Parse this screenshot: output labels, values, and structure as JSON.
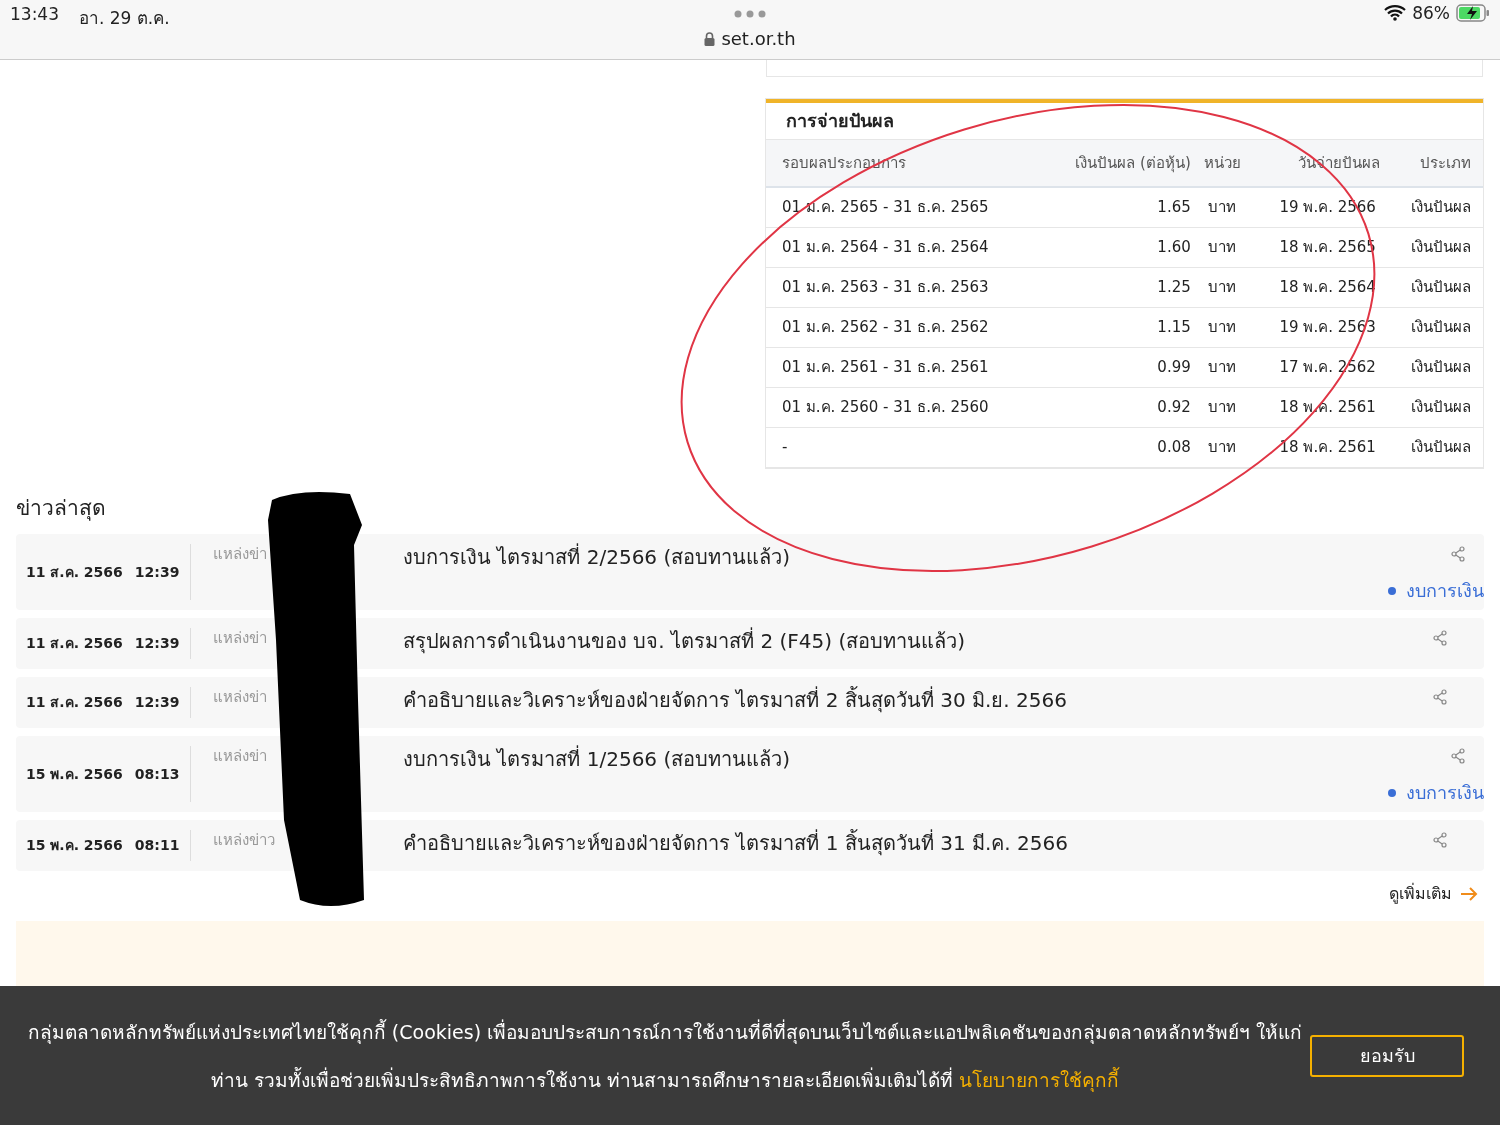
{
  "status_bar": {
    "time": "13:43",
    "date": "อา. 29 ต.ค.",
    "url": "set.or.th",
    "battery": "86%"
  },
  "dividend": {
    "title": "การจ่ายปันผล",
    "columns": [
      "รอบผลประกอบการ",
      "เงินปันผล (ต่อหุ้น)",
      "หน่วย",
      "วันจ่ายปันผล",
      "ประเภท"
    ],
    "rows": [
      {
        "period": "01 ม.ค. 2565 - 31 ธ.ค. 2565",
        "amount": "1.65",
        "unit": "บาท",
        "pay_date": "19 พ.ค. 2566",
        "type": "เงินปันผล"
      },
      {
        "period": "01 ม.ค. 2564 - 31 ธ.ค. 2564",
        "amount": "1.60",
        "unit": "บาท",
        "pay_date": "18 พ.ค. 2565",
        "type": "เงินปันผล"
      },
      {
        "period": "01 ม.ค. 2563 - 31 ธ.ค. 2563",
        "amount": "1.25",
        "unit": "บาท",
        "pay_date": "18 พ.ค. 2564",
        "type": "เงินปันผล"
      },
      {
        "period": "01 ม.ค. 2562 - 31 ธ.ค. 2562",
        "amount": "1.15",
        "unit": "บาท",
        "pay_date": "19 พ.ค. 2563",
        "type": "เงินปันผล"
      },
      {
        "period": "01 ม.ค. 2561 - 31 ธ.ค. 2561",
        "amount": "0.99",
        "unit": "บาท",
        "pay_date": "17 พ.ค. 2562",
        "type": "เงินปันผล"
      },
      {
        "period": "01 ม.ค. 2560 - 31 ธ.ค. 2560",
        "amount": "0.92",
        "unit": "บาท",
        "pay_date": "18 พ.ค. 2561",
        "type": "เงินปันผล"
      },
      {
        "period": "-",
        "amount": "0.08",
        "unit": "บาท",
        "pay_date": "18 พ.ค. 2561",
        "type": "เงินปันผล"
      }
    ]
  },
  "news": {
    "title": "ข่าวล่าสุด",
    "items": [
      {
        "date": "11 ส.ค. 2566",
        "time": "12:39",
        "source": "แหล่งข่า",
        "headline": "งบการเงิน ไตรมาสที่ 2/2566 (สอบทานแล้ว)",
        "tag": "งบการเงิน"
      },
      {
        "date": "11 ส.ค. 2566",
        "time": "12:39",
        "source": "แหล่งข่า",
        "headline": "สรุปผลการดำเนินงานของ บจ. ไตรมาสที่ 2 (F45) (สอบทานแล้ว)"
      },
      {
        "date": "11 ส.ค. 2566",
        "time": "12:39",
        "source": "แหล่งข่า",
        "headline": "คำอธิบายและวิเคราะห์ของฝ่ายจัดการ ไตรมาสที่ 2 สิ้นสุดวันที่ 30 มิ.ย. 2566"
      },
      {
        "date": "15 พ.ค. 2566",
        "time": "08:13",
        "source": "แหล่งข่า",
        "headline": "งบการเงิน ไตรมาสที่ 1/2566 (สอบทานแล้ว)",
        "tag": "งบการเงิน"
      },
      {
        "date": "15 พ.ค. 2566",
        "time": "08:11",
        "source": "แหล่งข่าว",
        "headline": "คำอธิบายและวิเคราะห์ของฝ่ายจัดการ ไตรมาสที่ 1 สิ้นสุดวันที่ 31 มี.ค. 2566"
      }
    ],
    "more_link": "ดูเพิ่มเติม"
  },
  "cookie_banner": {
    "text": "กลุ่มตลาดหลักทรัพย์แห่งประเทศไทยใช้คุกกี้ (Cookies) เพื่อมอบประสบการณ์การใช้งานที่ดีที่สุดบนเว็บไซต์และแอปพลิเคชันของกลุ่มตลาดหลักทรัพย์ฯ ให้แก่ท่าน รวมทั้งเพื่อช่วยเพิ่มประสิทธิภาพการใช้งาน ท่านสามารถศึกษารายละเอียดเพิ่มเติมได้ที่",
    "link": "นโยบายการใช้คุกกี้",
    "button": "ยอมรับ"
  }
}
